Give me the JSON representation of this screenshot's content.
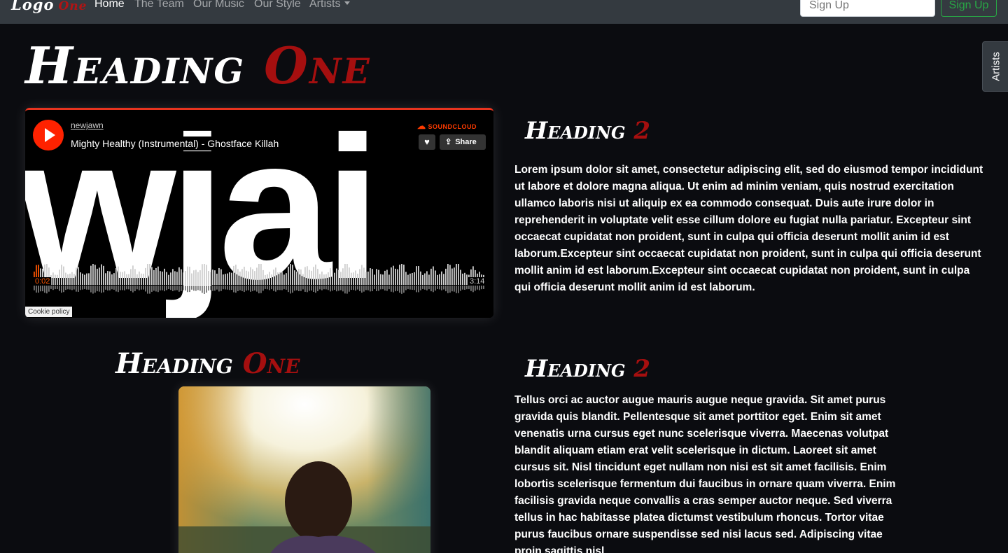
{
  "navbar": {
    "logo_main": "Logo",
    "logo_accent": "One",
    "links": [
      "Home",
      "The Team",
      "Our Music",
      "Our Style",
      "Artists"
    ],
    "signup_placeholder": "Sign Up",
    "signup_button": "Sign Up"
  },
  "side_tab": {
    "label": "Artists"
  },
  "section1": {
    "heading_main": "Heading",
    "heading_accent": "One",
    "player": {
      "artist": "newjawn",
      "track": "Mighty Healthy (Instrumental) - Ghostface Killah",
      "brand": "SOUNDCLOUD",
      "share_label": "Share",
      "current_time": "0:02",
      "total_time": "3:14",
      "cookie_label": "Cookie policy",
      "progress": 0.01
    },
    "subheading_main": "Heading",
    "subheading_accent": "2",
    "paragraph": "Lorem ipsum dolor sit amet, consectetur adipiscing elit, sed do eiusmod tempor incididunt ut labore et dolore magna aliqua. Ut enim ad minim veniam, quis nostrud exercitation ullamco laboris nisi ut aliquip ex ea commodo consequat. Duis aute irure dolor in reprehenderit in voluptate velit esse cillum dolore eu fugiat nulla pariatur. Excepteur sint occaecat cupidatat non proident, sunt in culpa qui officia deserunt mollit anim id est laborum.Excepteur sint occaecat cupidatat non proident, sunt in culpa qui officia deserunt mollit anim id est laborum.Excepteur sint occaecat cupidatat non proident, sunt in culpa qui officia deserunt mollit anim id est laborum."
  },
  "section2": {
    "heading_main": "Heading",
    "heading_accent": "One",
    "subheading_main": "Heading",
    "subheading_accent": "2",
    "paragraph": "Tellus orci ac auctor augue mauris augue neque gravida. Sit amet purus gravida quis blandit. Pellentesque sit amet porttitor eget. Enim sit amet venenatis urna cursus eget nunc scelerisque viverra. Maecenas volutpat blandit aliquam etiam erat velit scelerisque in dictum. Laoreet sit amet cursus sit. Nisl tincidunt eget nullam non nisi est sit amet facilisis. Enim lobortis scelerisque fermentum dui faucibus in ornare quam viverra. Enim facilisis gravida neque convallis a cras semper auctor neque. Sed viverra tellus in hac habitasse platea dictumst vestibulum rhoncus. Tortor vitae purus faucibus ornare suspendisse sed nisi lacus sed. Adipiscing vitae proin sagittis nisl"
  },
  "colors": {
    "accent_red": "#a50f0f",
    "soundcloud_orange": "#ff5500",
    "signup_green": "#28a745",
    "background": "#0b0c10",
    "navbar": "#343a40"
  },
  "icons": [
    "play-icon",
    "soundcloud-icon",
    "heart-icon",
    "share-icon",
    "caret-down-icon"
  ]
}
